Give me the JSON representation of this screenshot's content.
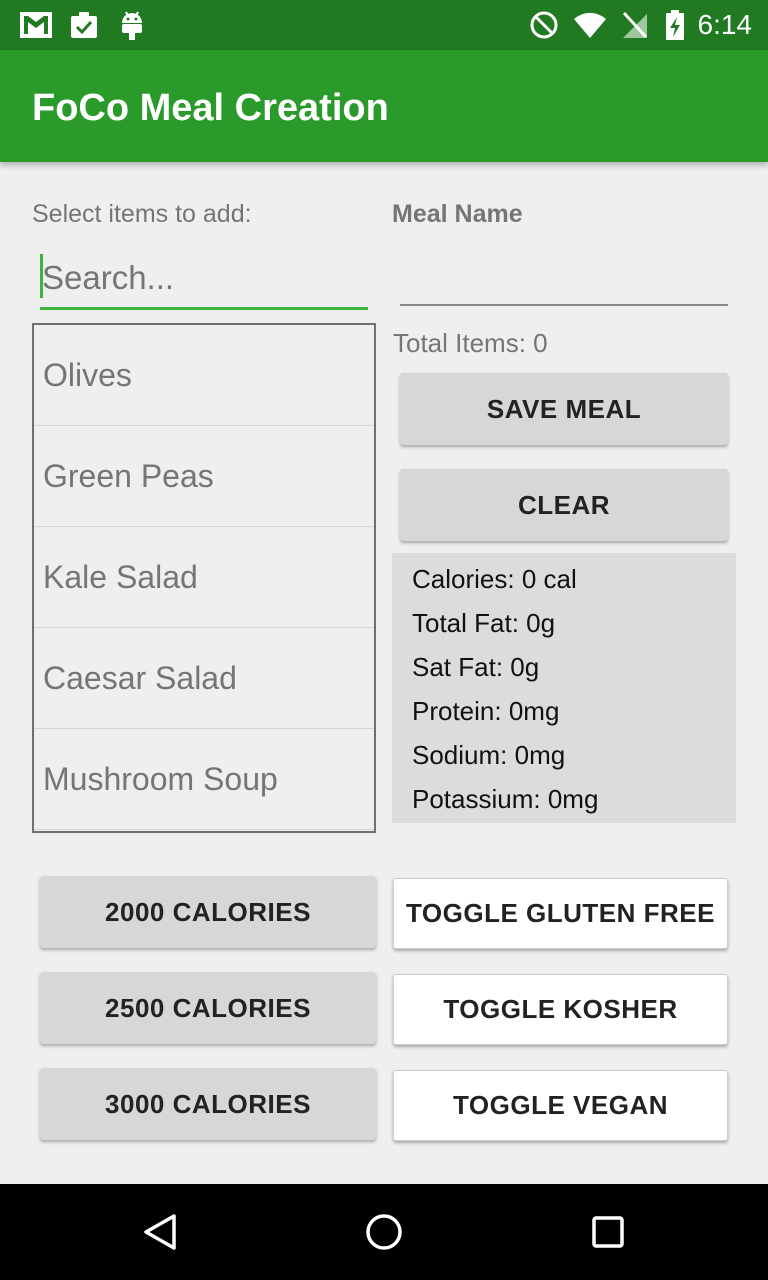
{
  "status_bar": {
    "time": "6:14",
    "left_icons": [
      "gmail-icon",
      "clipboard-check-icon",
      "android-icon"
    ],
    "right_icons": [
      "do-not-disturb-icon",
      "wifi-icon",
      "no-sim-icon",
      "battery-charging-icon"
    ]
  },
  "app_bar": {
    "title": "FoCo Meal Creation",
    "color": "#2a9b2a"
  },
  "left_panel": {
    "select_label": "Select items to add:",
    "search_placeholder": "Search...",
    "items": [
      "Olives",
      "Green Peas",
      "Kale Salad",
      "Caesar Salad",
      "Mushroom Soup"
    ]
  },
  "right_panel": {
    "meal_name_label": "Meal Name",
    "meal_name_value": "",
    "total_items": "Total Items: 0",
    "save_button": "SAVE MEAL",
    "clear_button": "CLEAR",
    "nutrition": [
      "Calories: 0 cal",
      "Total Fat: 0g",
      "Sat Fat: 0g",
      "Protein: 0mg",
      "Sodium: 0mg",
      "Potassium: 0mg"
    ]
  },
  "bottom_buttons": {
    "calories_2000": "2000 CALORIES",
    "calories_2500": "2500 CALORIES",
    "calories_3000": "3000 CALORIES",
    "toggle_gluten_free": "TOGGLE GLUTEN FREE",
    "toggle_kosher": "TOGGLE KOSHER",
    "toggle_vegan": "TOGGLE VEGAN"
  },
  "nav_bar": {
    "icons": [
      "back-icon",
      "home-icon",
      "recents-icon"
    ]
  }
}
